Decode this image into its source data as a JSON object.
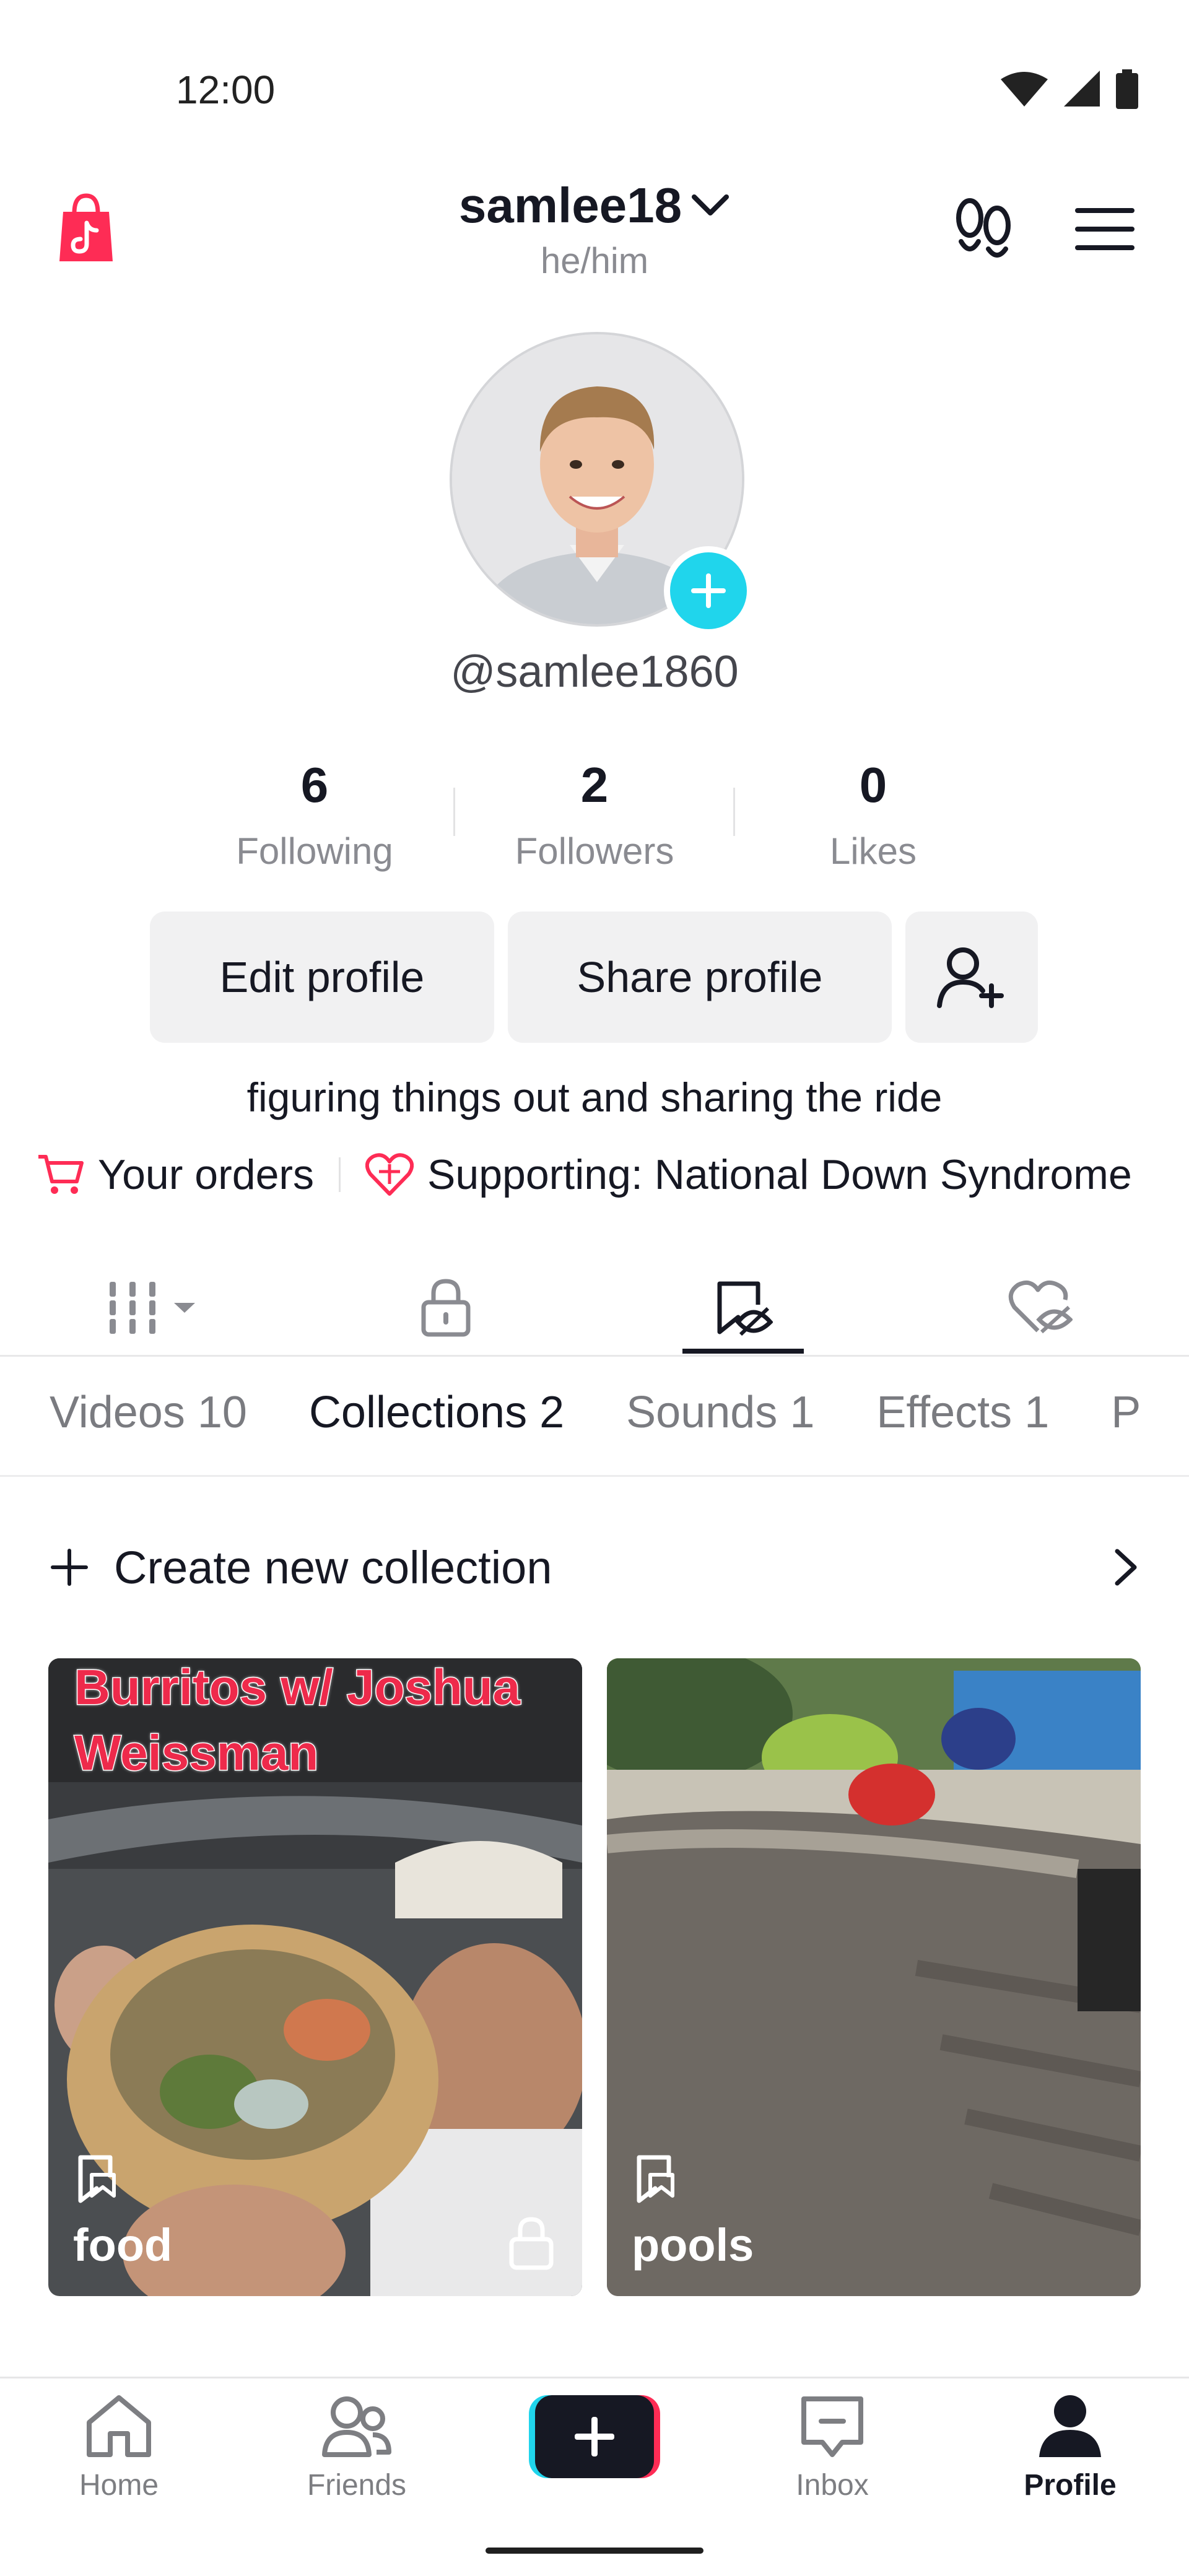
{
  "status_bar": {
    "time": "12:00"
  },
  "header": {
    "username": "samlee18",
    "pronouns": "he/him",
    "handle": "@samlee1860"
  },
  "stats": [
    {
      "value": "6",
      "label": "Following"
    },
    {
      "value": "2",
      "label": "Followers"
    },
    {
      "value": "0",
      "label": "Likes"
    }
  ],
  "actions": {
    "edit_profile": "Edit profile",
    "share_profile": "Share profile"
  },
  "bio": "figuring things out and sharing the ride",
  "links": {
    "orders": "Your orders",
    "supporting": "Supporting: National Down Syndrome"
  },
  "content_tabs": [
    "Videos 10",
    "Collections 2",
    "Sounds 1",
    "Effects 1",
    "P"
  ],
  "active_content_tab": "Collections 2",
  "create_collection_label": "Create new collection",
  "collections": [
    {
      "name": "food",
      "overlay_text": "Burritos w/ Joshua Weissman",
      "locked": true
    },
    {
      "name": "pools",
      "overlay_text": "",
      "locked": false
    }
  ],
  "bottom_nav": [
    {
      "label": "Home",
      "active": false
    },
    {
      "label": "Friends",
      "active": false
    },
    {
      "label": "",
      "active": false
    },
    {
      "label": "Inbox",
      "active": false
    },
    {
      "label": "Profile",
      "active": true
    }
  ],
  "colors": {
    "accent_cyan": "#20d5ec",
    "accent_red": "#fe2c55",
    "text_primary": "#161823",
    "text_secondary": "#8a8b91",
    "button_bg": "#f1f1f2"
  },
  "icons": [
    "shop-bag-icon",
    "footprints-icon",
    "menu-icon",
    "add-friend-icon",
    "cart-icon",
    "heart-charity-icon",
    "grid-icon",
    "lock-icon",
    "bookmark-icon",
    "liked-hidden-icon",
    "plus-icon",
    "chevron-right-icon",
    "home-icon",
    "friends-icon",
    "create-icon",
    "inbox-icon",
    "profile-icon"
  ]
}
